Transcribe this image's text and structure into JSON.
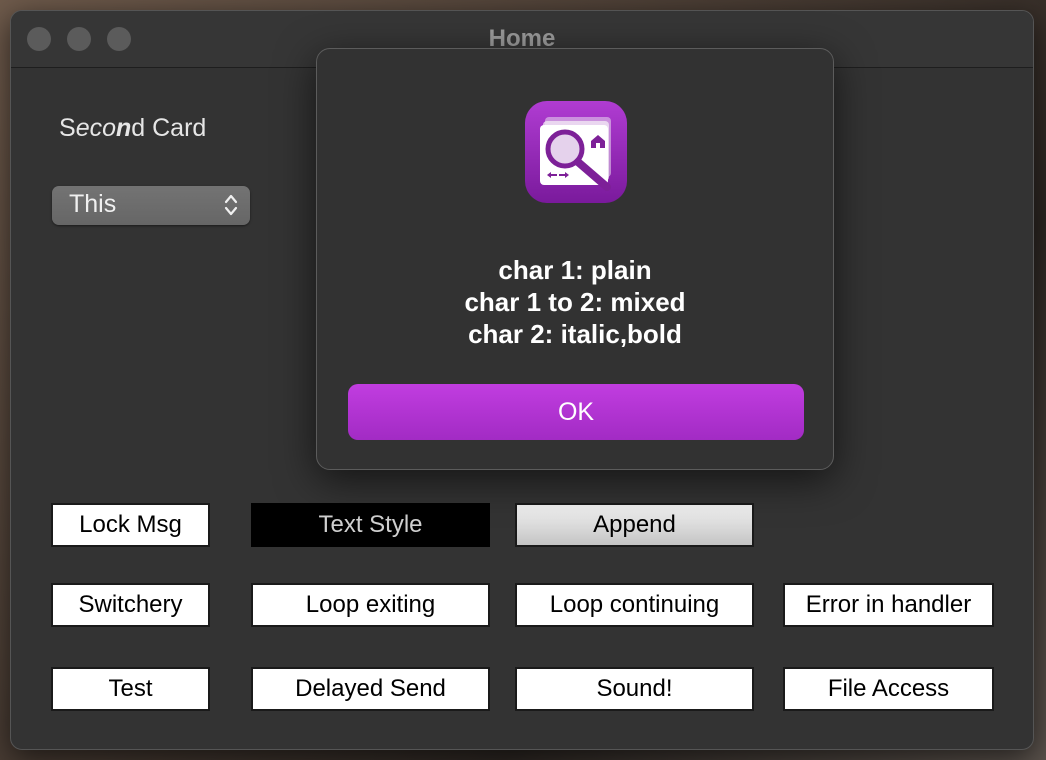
{
  "window": {
    "title": "Home"
  },
  "card": {
    "title_part1": "S",
    "title_part2": "eco",
    "title_part3": "n",
    "title_part4": "d Card",
    "popup_value": "This"
  },
  "buttons": {
    "lock_msg": "Lock Msg",
    "text_style": "Text Style",
    "append": "Append",
    "switchery": "Switchery",
    "loop_exiting": "Loop exiting",
    "loop_continuing": "Loop continuing",
    "error_in_handler": "Error in handler",
    "test": "Test",
    "delayed_send": "Delayed Send",
    "sound": "Sound!",
    "file_access": "File Access"
  },
  "dialog": {
    "line1": "char 1: plain",
    "line2": "char 1 to 2: mixed",
    "line3": "char 2: italic,bold",
    "ok_label": "OK",
    "icon": "app-magnifier-icon"
  },
  "colors": {
    "accent": "#b535d6",
    "window_bg": "#333333"
  }
}
